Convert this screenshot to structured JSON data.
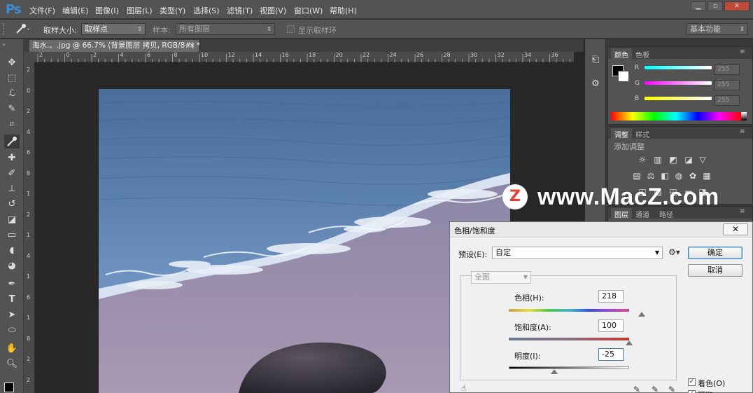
{
  "app": {
    "logo": "Ps",
    "menu": [
      "文件(F)",
      "编辑(E)",
      "图像(I)",
      "图层(L)",
      "类型(Y)",
      "选择(S)",
      "滤镜(T)",
      "视图(V)",
      "窗口(W)",
      "帮助(H)"
    ],
    "window_buttons": [
      "▁",
      "▫",
      "✕"
    ]
  },
  "options": {
    "sample_size_label": "取样大小:",
    "sample_size_value": "取样点",
    "sample_label": "样本:",
    "sample_value": "所有图层",
    "show_ring_label": "显示取样环",
    "workspace": "基本功能"
  },
  "document": {
    "tab_title": "海水.。.jpg @ 66.7% (背景图层 拷贝, RGB/8#) *",
    "close_glyph": "×",
    "ruler_top": [
      "2",
      "0",
      "2",
      "4",
      "6",
      "8",
      "10",
      "12",
      "14",
      "16",
      "18",
      "20",
      "22",
      "24",
      "26",
      "28",
      "30",
      "32",
      "34",
      "36"
    ],
    "ruler_left": [
      "2",
      "0",
      "2",
      "4",
      "6",
      "8",
      "1",
      "2",
      "1",
      "4",
      "1",
      "6",
      "1",
      "8",
      "2",
      "2"
    ]
  },
  "panels": {
    "color_tabs": [
      "颜色",
      "色板"
    ],
    "channels": [
      {
        "label": "R",
        "value": "255"
      },
      {
        "label": "G",
        "value": "255"
      },
      {
        "label": "B",
        "value": "255"
      }
    ],
    "adjust_tabs": [
      "调整",
      "样式"
    ],
    "adjust_title": "添加调整",
    "layer_tabs": [
      "图层",
      "通道",
      "路径"
    ]
  },
  "watermark": {
    "badge": "Z",
    "text": "www.MacZ.com"
  },
  "dialog": {
    "title": "色相/饱和度",
    "close": "✕",
    "preset_label": "预设(E):",
    "preset_value": "自定",
    "channel_value": "全图",
    "hue_label": "色相(H):",
    "hue_value": "218",
    "sat_label": "饱和度(A):",
    "sat_value": "100",
    "light_label": "明度(I):",
    "light_value": "-25",
    "ok": "确定",
    "cancel": "取消",
    "colorize_label": "着色(O)",
    "colorize_checked": true,
    "preview_label": "预览",
    "preview_checked": true
  },
  "sliders": {
    "hue": 218,
    "hue_min": -180,
    "hue_max": 180,
    "saturation": 100,
    "saturation_min": 0,
    "saturation_max": 100,
    "lightness": -25,
    "lightness_min": -100,
    "lightness_max": 100
  }
}
